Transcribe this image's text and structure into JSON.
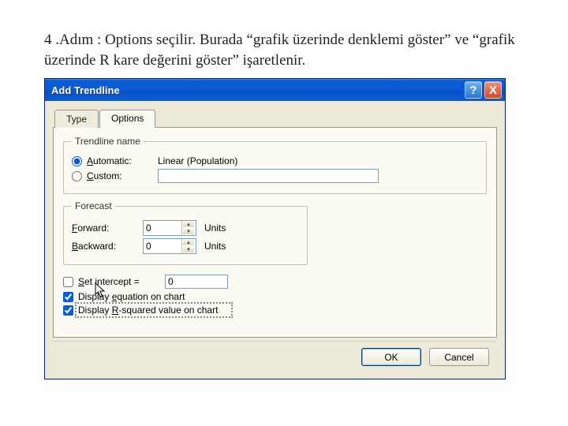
{
  "instruction_text": "4 .Adım : Options seçilir. Burada “grafik üzerinde denklemi göster” ve “grafik üzerinde R kare değerini göster” işaretlenir.",
  "window": {
    "title": "Add Trendline",
    "help_tooltip": "?",
    "close_tooltip": "X"
  },
  "tabs": {
    "type": "Type",
    "options": "Options",
    "active": "options"
  },
  "trendline_name": {
    "legend": "Trendline name",
    "automatic_prefix": "A",
    "automatic_rest": "utomatic:",
    "automatic_value": "Linear (Population)",
    "custom_prefix": "C",
    "custom_rest": "ustom:",
    "selected": "automatic",
    "custom_value": ""
  },
  "forecast": {
    "legend": "Forecast",
    "forward_prefix": "F",
    "forward_rest": "orward:",
    "forward_value": "0",
    "backward_prefix": "B",
    "backward_rest": "ackward:",
    "backward_value": "0",
    "units": "Units"
  },
  "checks": {
    "set_intercept_prefix": "S",
    "set_intercept_rest": "et intercept =",
    "set_intercept_checked": false,
    "set_intercept_value": "0",
    "display_eq_pre": "Display ",
    "display_eq_u": "e",
    "display_eq_post": "quation on chart",
    "display_eq_checked": true,
    "display_r2_pre": "Display ",
    "display_r2_u": "R",
    "display_r2_post": "-squared value on chart",
    "display_r2_checked": true
  },
  "buttons": {
    "ok": "OK",
    "cancel": "Cancel"
  }
}
